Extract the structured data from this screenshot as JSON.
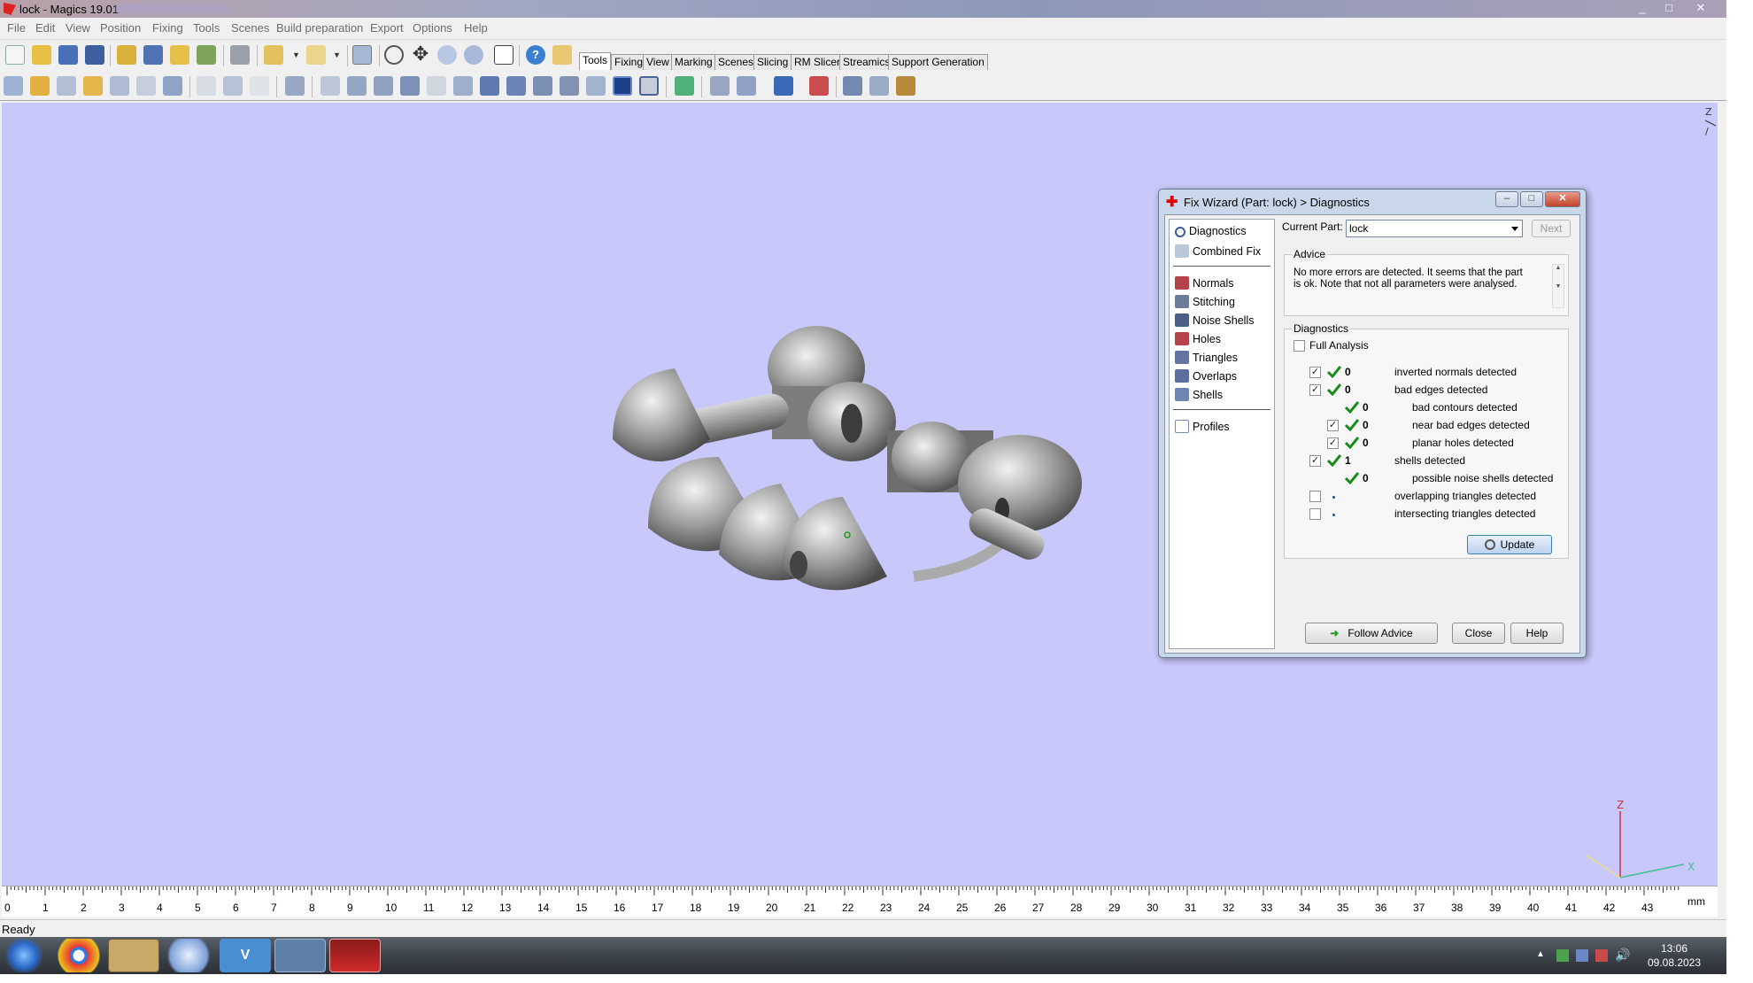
{
  "window": {
    "title": "lock - Magics 19.01",
    "controls": {
      "minimize": "_",
      "maximize": "□",
      "close": "✕"
    }
  },
  "menu": [
    "File",
    "Edit",
    "View",
    "Position",
    "Fixing",
    "Tools",
    "Scenes",
    "Build preparation",
    "Export",
    "Options",
    "Help"
  ],
  "tabs": [
    "Tools",
    "Fixing",
    "View",
    "Marking",
    "Scenes",
    "Slicing",
    "RM Slicer",
    "Streamics",
    "Support Generation"
  ],
  "active_tab": "Tools",
  "ruler": {
    "ticks": [
      "0",
      "1",
      "2",
      "3",
      "4",
      "5",
      "6",
      "7",
      "8",
      "9",
      "10",
      "11",
      "12",
      "13",
      "14",
      "15",
      "16",
      "17",
      "18",
      "19",
      "20",
      "21",
      "22",
      "23",
      "24",
      "25",
      "26",
      "27",
      "28",
      "29",
      "30",
      "31",
      "32",
      "33",
      "34",
      "35",
      "36",
      "37",
      "38",
      "39",
      "40",
      "41",
      "42",
      "43"
    ],
    "unit": "mm"
  },
  "status": "Ready",
  "taskbar": {
    "time": "13:06",
    "date": "09.08.2023"
  },
  "axes": {
    "z": "Z",
    "x": "X"
  },
  "fix_wizard": {
    "title": "Fix Wizard (Part: lock) > Diagnostics",
    "nav": {
      "top": [
        "Diagnostics",
        "Combined Fix"
      ],
      "middle": [
        "Normals",
        "Stitching",
        "Noise Shells",
        "Holes",
        "Triangles",
        "Overlaps",
        "Shells"
      ],
      "bottom": [
        "Profiles"
      ]
    },
    "current_part_label": "Current Part:",
    "current_part_value": "lock",
    "next_label": "Next",
    "advice_title": "Advice",
    "advice_text": "No more errors are detected. It seems that the part is ok. Note that not all parameters were analysed.",
    "diagnostics_title": "Diagnostics",
    "full_analysis_label": "Full Analysis",
    "rows": [
      {
        "count": "0",
        "label": "inverted normals detected"
      },
      {
        "count": "0",
        "label": "bad edges detected"
      },
      {
        "count": "0",
        "label": "bad contours detected"
      },
      {
        "count": "0",
        "label": "near bad edges detected"
      },
      {
        "count": "0",
        "label": "planar holes detected"
      },
      {
        "count": "1",
        "label": "shells detected"
      },
      {
        "count": "0",
        "label": "possible noise shells detected"
      },
      {
        "count": "",
        "label": "overlapping triangles detected"
      },
      {
        "count": "",
        "label": "intersecting triangles detected"
      }
    ],
    "update_label": "Update",
    "follow_advice_label": "Follow Advice",
    "close_label": "Close",
    "help_label": "Help"
  }
}
